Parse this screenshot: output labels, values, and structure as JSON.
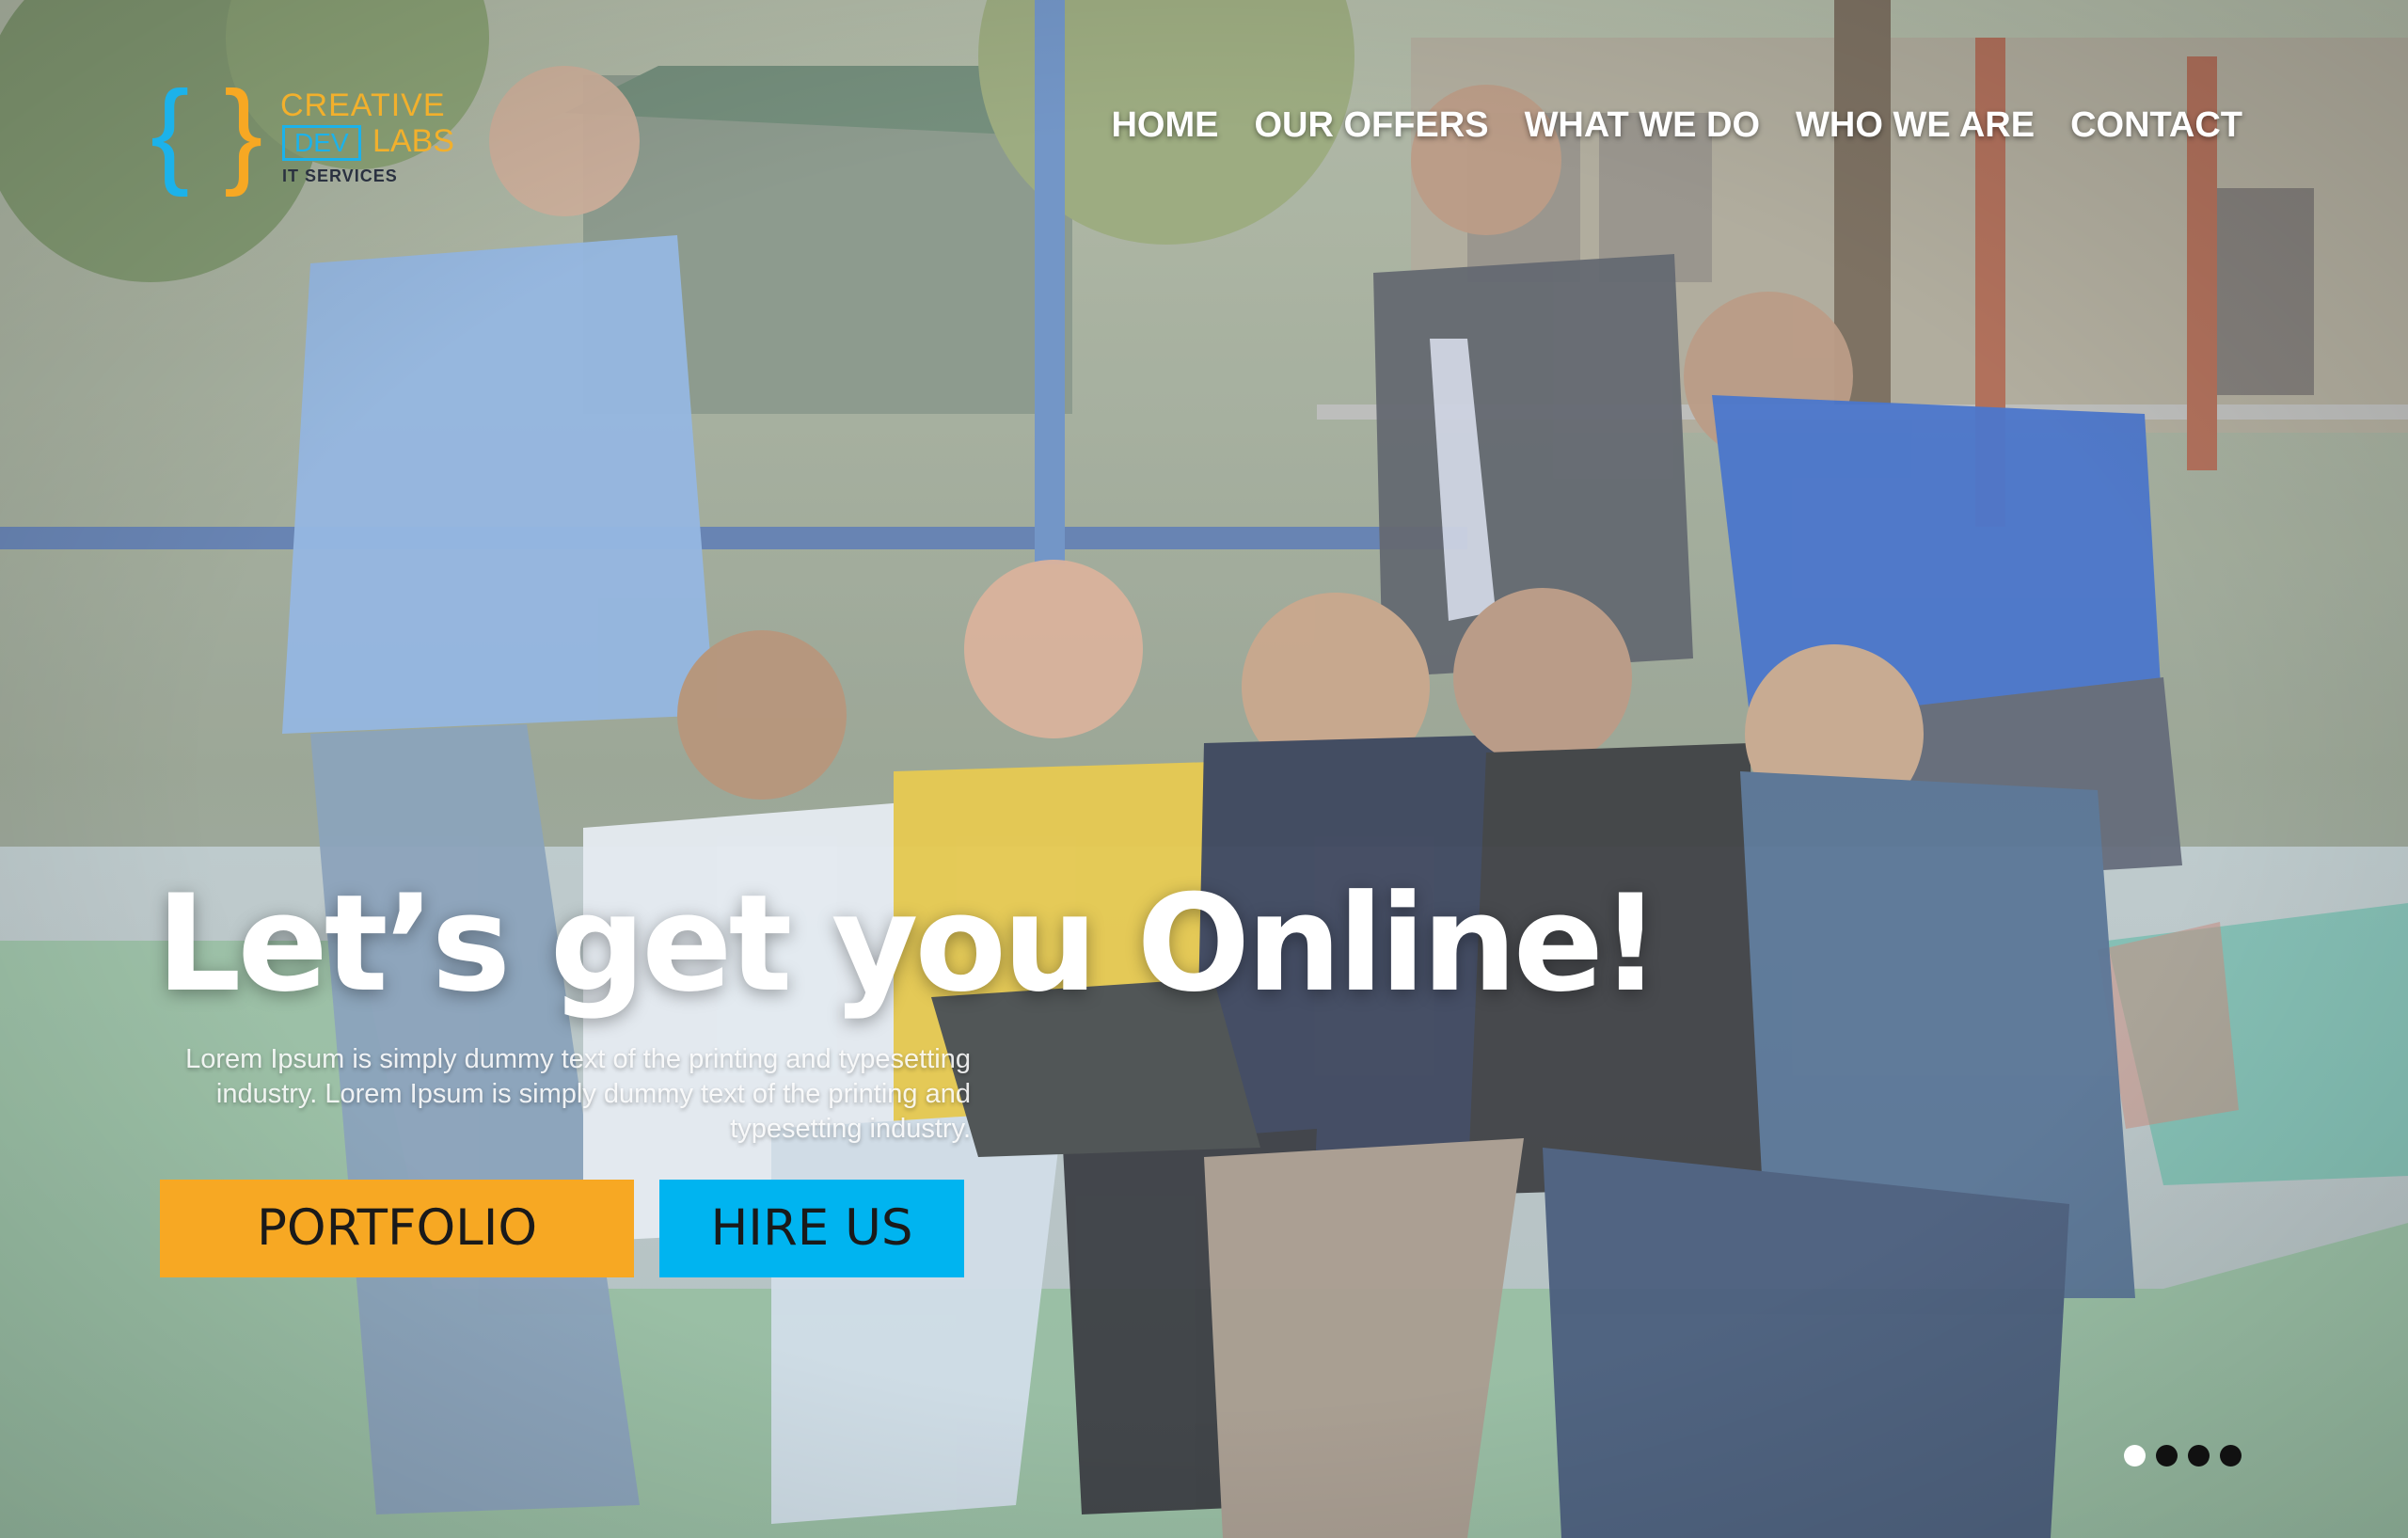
{
  "brand": {
    "brace_open": "{",
    "brace_close": "}",
    "line1": "CREATIVE",
    "dev": "DEV",
    "labs": "LABS",
    "subtitle": "IT SERVICES",
    "colors": {
      "blue": "#1cb2ea",
      "orange": "#f2b02c"
    }
  },
  "nav": {
    "items": [
      {
        "label": "HOME"
      },
      {
        "label": "OUR OFFERS"
      },
      {
        "label": "WHAT WE DO"
      },
      {
        "label": "WHO WE ARE"
      },
      {
        "label": "CONTACT"
      }
    ]
  },
  "hero": {
    "headline": "Let’s get you Online!",
    "tagline": "Lorem Ipsum is simply dummy text of the printing and typesetting industry. Lorem Ipsum is simply dummy text of the printing and typesetting industry.",
    "buttons": {
      "portfolio": "PORTFOLIO",
      "hire": "HIRE US"
    },
    "button_colors": {
      "portfolio": "#f7a823",
      "hire": "#00b4f0"
    }
  },
  "carousel": {
    "slide_count": 4,
    "active_index": 0
  }
}
